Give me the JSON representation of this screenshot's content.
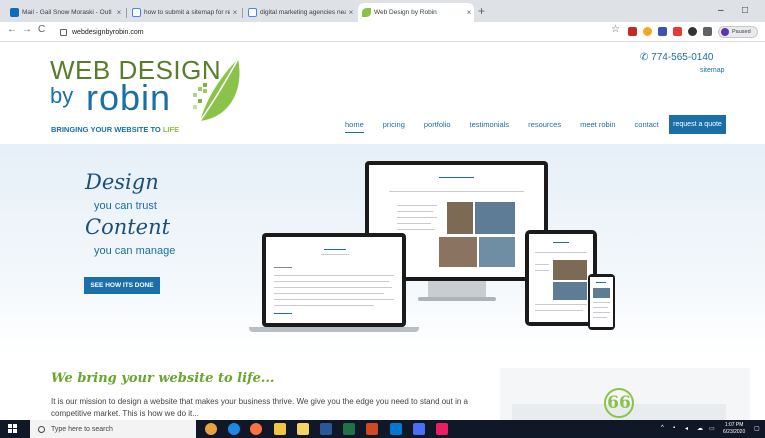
{
  "browser": {
    "tabs": [
      {
        "title": "Mail - Gail Snow Moraski - Outl",
        "favicon_color": "#0f6cbd",
        "active": false
      },
      {
        "title": "how to submit a sitemap for revi",
        "favicon_color": "#4285f4",
        "active": false
      },
      {
        "title": "digital marketing agencies near",
        "favicon_color": "#4285f4",
        "active": false
      },
      {
        "title": "Web Design by Robin",
        "favicon_color": "#8bc34a",
        "active": true
      }
    ],
    "new_tab_label": "+",
    "minimize_label": "–",
    "restore_label": "□",
    "back_label": "←",
    "forward_label": "→",
    "reload_label": "C",
    "url": "webdesignbyrobin.com",
    "star_label": "☆",
    "profile_status": "Paused",
    "colors": {
      "accent": "#1a6fa8",
      "green": "#8bc34a"
    }
  },
  "site": {
    "logo": {
      "line1": "WEB DESIGN",
      "line2": "by",
      "line3": "robin",
      "tagline": "BRINGING YOUR WEBSITE TO",
      "tagline_highlight": "LIFE"
    },
    "phone": "774-565-0140",
    "sitemap": "sitemap",
    "nav": [
      {
        "label": "home",
        "current": true
      },
      {
        "label": "pricing",
        "current": false
      },
      {
        "label": "portfolio",
        "current": false
      },
      {
        "label": "testimonials",
        "current": false
      },
      {
        "label": "resources",
        "current": false
      },
      {
        "label": "meet robin",
        "current": false
      },
      {
        "label": "contact",
        "current": false
      }
    ],
    "quote_button": "request a quote",
    "hero": {
      "word1": "Design",
      "sub1": "you can trust",
      "word2": "Content",
      "sub2": "you can manage",
      "cta": "SEE HOW ITS DONE"
    },
    "tagline": "We bring your website to life...",
    "mission": "It is our mission to design a website that makes your business thrive. We give you the edge you need to stand out in a competitive market. This is how we do it...",
    "quote_mark": "66"
  },
  "taskbar": {
    "search_placeholder": "Type here to search",
    "time": "1:07 PM",
    "date": "6/23/2020"
  }
}
